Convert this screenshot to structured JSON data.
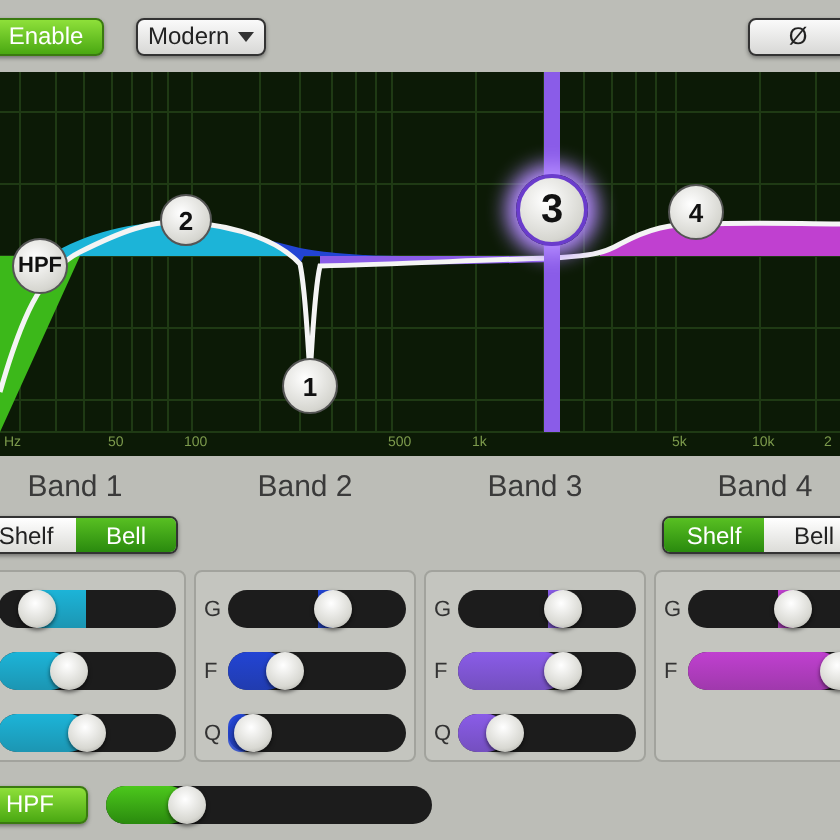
{
  "toolbar": {
    "enable": {
      "label": "Enable",
      "on": true
    },
    "curve_mode": {
      "value": "Modern"
    },
    "phase_button": {
      "label": "Ø"
    }
  },
  "graph": {
    "nodes": [
      {
        "label": "HPF",
        "selected": false
      },
      {
        "label": "2",
        "selected": false
      },
      {
        "label": "1",
        "selected": false
      },
      {
        "label": "3",
        "selected": true
      },
      {
        "label": "4",
        "selected": false
      }
    ],
    "axis_labels": [
      "Hz",
      "50",
      "100",
      "500",
      "1k",
      "5k",
      "10k",
      "2"
    ]
  },
  "bands": [
    {
      "name": "Band 1",
      "color": "#1cb4d8",
      "shape_options": [
        {
          "label": "Shelf",
          "selected": false
        },
        {
          "label": "Bell",
          "selected": true
        }
      ],
      "sliders": [
        {
          "kind": "gain",
          "level": 0.15
        },
        {
          "kind": "freq",
          "level": 0.37
        },
        {
          "kind": "q",
          "level": 0.5
        }
      ]
    },
    {
      "name": "Band 2",
      "color": "#2244d4",
      "sliders": [
        {
          "kind": "gain",
          "label": "G",
          "level": 0.62
        },
        {
          "kind": "freq",
          "label": "F",
          "level": 0.28
        },
        {
          "kind": "q",
          "label": "Q",
          "level": 0.04
        }
      ]
    },
    {
      "name": "Band 3",
      "color": "#8a5ce8",
      "sliders": [
        {
          "kind": "gain",
          "label": "G",
          "level": 0.63
        },
        {
          "kind": "freq",
          "label": "F",
          "level": 0.63
        },
        {
          "kind": "q",
          "label": "Q",
          "level": 0.2
        }
      ]
    },
    {
      "name": "Band 4",
      "color": "#c040d0",
      "shape_options": [
        {
          "label": "Shelf",
          "selected": true
        },
        {
          "label": "Bell",
          "selected": false
        }
      ],
      "sliders": [
        {
          "kind": "gain",
          "label": "G",
          "level": 0.62
        },
        {
          "kind": "freq",
          "label": "F",
          "level": 0.95
        }
      ]
    }
  ],
  "hpf": {
    "label": "HPF",
    "on": true,
    "level": 0.22
  }
}
